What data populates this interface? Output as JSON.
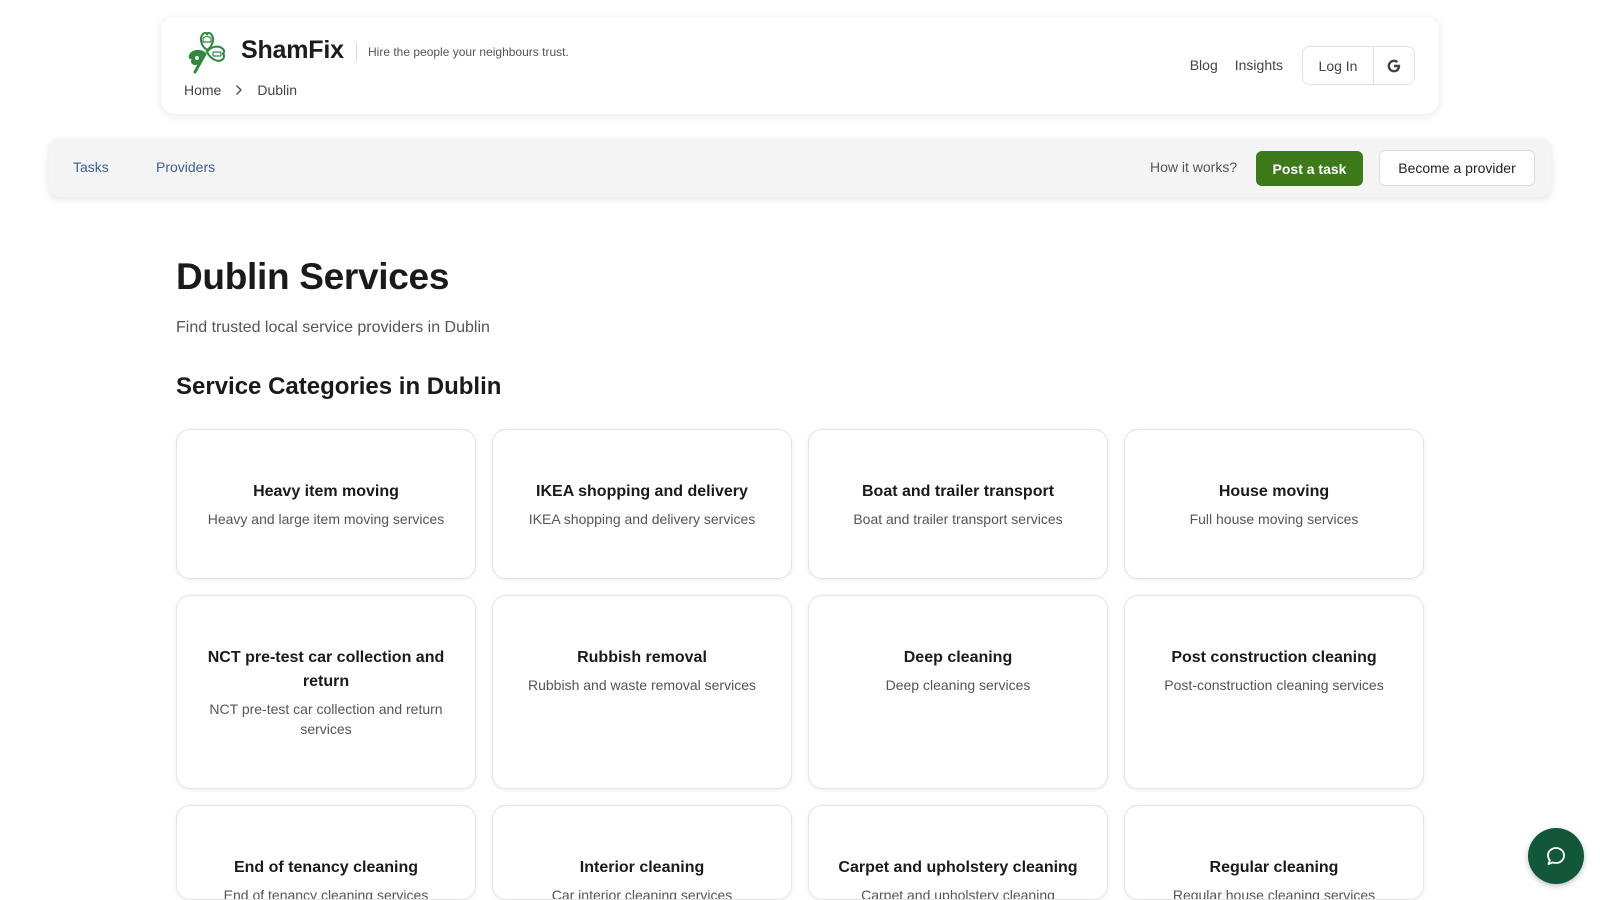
{
  "header": {
    "brand": "ShamFix",
    "tagline": "Hire the people your neighbours trust.",
    "breadcrumb": [
      "Home",
      "Dublin"
    ],
    "nav": [
      "Blog",
      "Insights"
    ],
    "login_label": "Log In",
    "google_icon": "google-icon",
    "brand_color": "#2e8b3e"
  },
  "navbar": {
    "tasks": "Tasks",
    "providers": "Providers",
    "how_it_works": "How it works?",
    "post_task": "Post a task",
    "become_provider": "Become a provider",
    "accent": "#3d7a1a",
    "link_color": "#3c5f95"
  },
  "main": {
    "title": "Dublin Services",
    "subtitle": "Find trusted local service providers in Dublin",
    "section_title": "Service Categories in Dublin",
    "categories": [
      {
        "title": "Heavy item moving",
        "desc": "Heavy and large item moving services"
      },
      {
        "title": "IKEA shopping and delivery",
        "desc": "IKEA shopping and delivery services"
      },
      {
        "title": "Boat and trailer transport",
        "desc": "Boat and trailer transport services"
      },
      {
        "title": "House moving",
        "desc": "Full house moving services"
      },
      {
        "title": "NCT pre-test car collection and return",
        "desc": "NCT pre-test car collection and return services"
      },
      {
        "title": "Rubbish removal",
        "desc": "Rubbish and waste removal services"
      },
      {
        "title": "Deep cleaning",
        "desc": "Deep cleaning services"
      },
      {
        "title": "Post construction cleaning",
        "desc": "Post-construction cleaning services"
      },
      {
        "title": "End of tenancy cleaning",
        "desc": "End of tenancy cleaning services"
      },
      {
        "title": "Interior cleaning",
        "desc": "Car interior cleaning services"
      },
      {
        "title": "Carpet and upholstery cleaning",
        "desc": "Carpet and upholstery cleaning"
      },
      {
        "title": "Regular cleaning",
        "desc": "Regular house cleaning services"
      }
    ]
  },
  "chat": {
    "icon": "chat-bubble-icon",
    "color": "#12573a"
  }
}
